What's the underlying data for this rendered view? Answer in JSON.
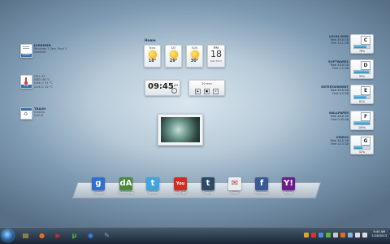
{
  "left_widgets": [
    {
      "title": "JOGRIDER",
      "lines": [
        "Windows 7 Serv. Pack 1",
        "Installed"
      ],
      "icon_name": "computer-icon",
      "caption": "System"
    },
    {
      "title": "",
      "lines": [
        "CPU:   22",
        "HDD:   46 °C",
        "Core 1: 51 °C",
        "Core 2: 42 °C"
      ],
      "icon_name": "thermometer-icon",
      "caption": "Temp"
    },
    {
      "title": "TRASH",
      "lines": [
        "0 Items",
        "0.00 B"
      ],
      "icon_name": "recycle-bin-icon",
      "caption": ""
    }
  ],
  "weather": {
    "location": "Home",
    "days": [
      {
        "day": "Now",
        "temp": "18°"
      },
      {
        "day": "SAT",
        "temp": "29°"
      },
      {
        "day": "SUN",
        "temp": "30°"
      }
    ],
    "calendar": {
      "weekday": "FRI",
      "day": "18",
      "month_year": "JAN 2013"
    }
  },
  "clock_widget": {
    "time": "09:45",
    "period": "AM"
  },
  "timer_widget": {
    "label": "20 min"
  },
  "drives": [
    {
      "name": "LOCAL DISK",
      "letter": "C",
      "total": "Total 48.8 GB",
      "free": "Free 10.1 GB",
      "percent": "78%",
      "fill": 0.78
    },
    {
      "name": "SOFTWARES",
      "letter": "D",
      "total": "Total 48.8 GB",
      "free": "Free 2.2 GB",
      "percent": "95%",
      "fill": 0.95
    },
    {
      "name": "ENTERTAINMENT",
      "letter": "E",
      "total": "Total 48.8 GB",
      "free": "Free 9.0 GB",
      "percent": "81%",
      "fill": 0.81
    },
    {
      "name": "WALLPAPER",
      "letter": "F",
      "total": "Total 48.8 GB",
      "free": "Free 0.00 GB",
      "percent": "100%",
      "fill": 1.0
    },
    {
      "name": "VIDEOS",
      "letter": "G",
      "total": "Total 48.8 GB",
      "free": "Free 23.3 GB",
      "percent": "52%",
      "fill": 0.52
    }
  ],
  "dock": [
    {
      "label": "Google",
      "glyph": "g",
      "color": "#2f6fcf",
      "icon_name": "google-icon"
    },
    {
      "label": "Deviantart",
      "glyph": "dA",
      "color": "#4a8a3c",
      "icon_name": "deviantart-icon"
    },
    {
      "label": "Twitter",
      "glyph": "t",
      "color": "#3fa4e0",
      "icon_name": "twitter-icon"
    },
    {
      "label": "YouTube",
      "glyph": "You",
      "color": "#d62b23",
      "icon_name": "youtube-icon"
    },
    {
      "label": "Tumblr",
      "glyph": "t",
      "color": "#2f4a66",
      "icon_name": "tumblr-icon"
    },
    {
      "label": "Gmail",
      "glyph": "✉",
      "color": "#e9edf2",
      "icon_name": "gmail-icon"
    },
    {
      "label": "Facebook",
      "glyph": "f",
      "color": "#3b5998",
      "icon_name": "facebook-icon"
    },
    {
      "label": "Yahoo",
      "glyph": "Y!",
      "color": "#6b1d8f",
      "icon_name": "yahoo-icon"
    }
  ],
  "taskbar": {
    "pinned": [
      {
        "icon_name": "explorer-folder-icon",
        "glyph": "▤",
        "color": "#e7b84a"
      },
      {
        "icon_name": "firefox-icon",
        "glyph": "●",
        "color": "#e66a1f"
      },
      {
        "icon_name": "media-player-icon",
        "glyph": "▶",
        "color": "#c92a2a"
      },
      {
        "icon_name": "utorrent-icon",
        "glyph": "µ",
        "color": "#5bb33b"
      },
      {
        "icon_name": "chrome-icon",
        "glyph": "◉",
        "color": "#4285f4"
      },
      {
        "icon_name": "paint-icon",
        "glyph": "✎",
        "color": "#7aa5c9"
      }
    ],
    "clock_time": "9:45 AM",
    "clock_date": "1/18/2013"
  }
}
